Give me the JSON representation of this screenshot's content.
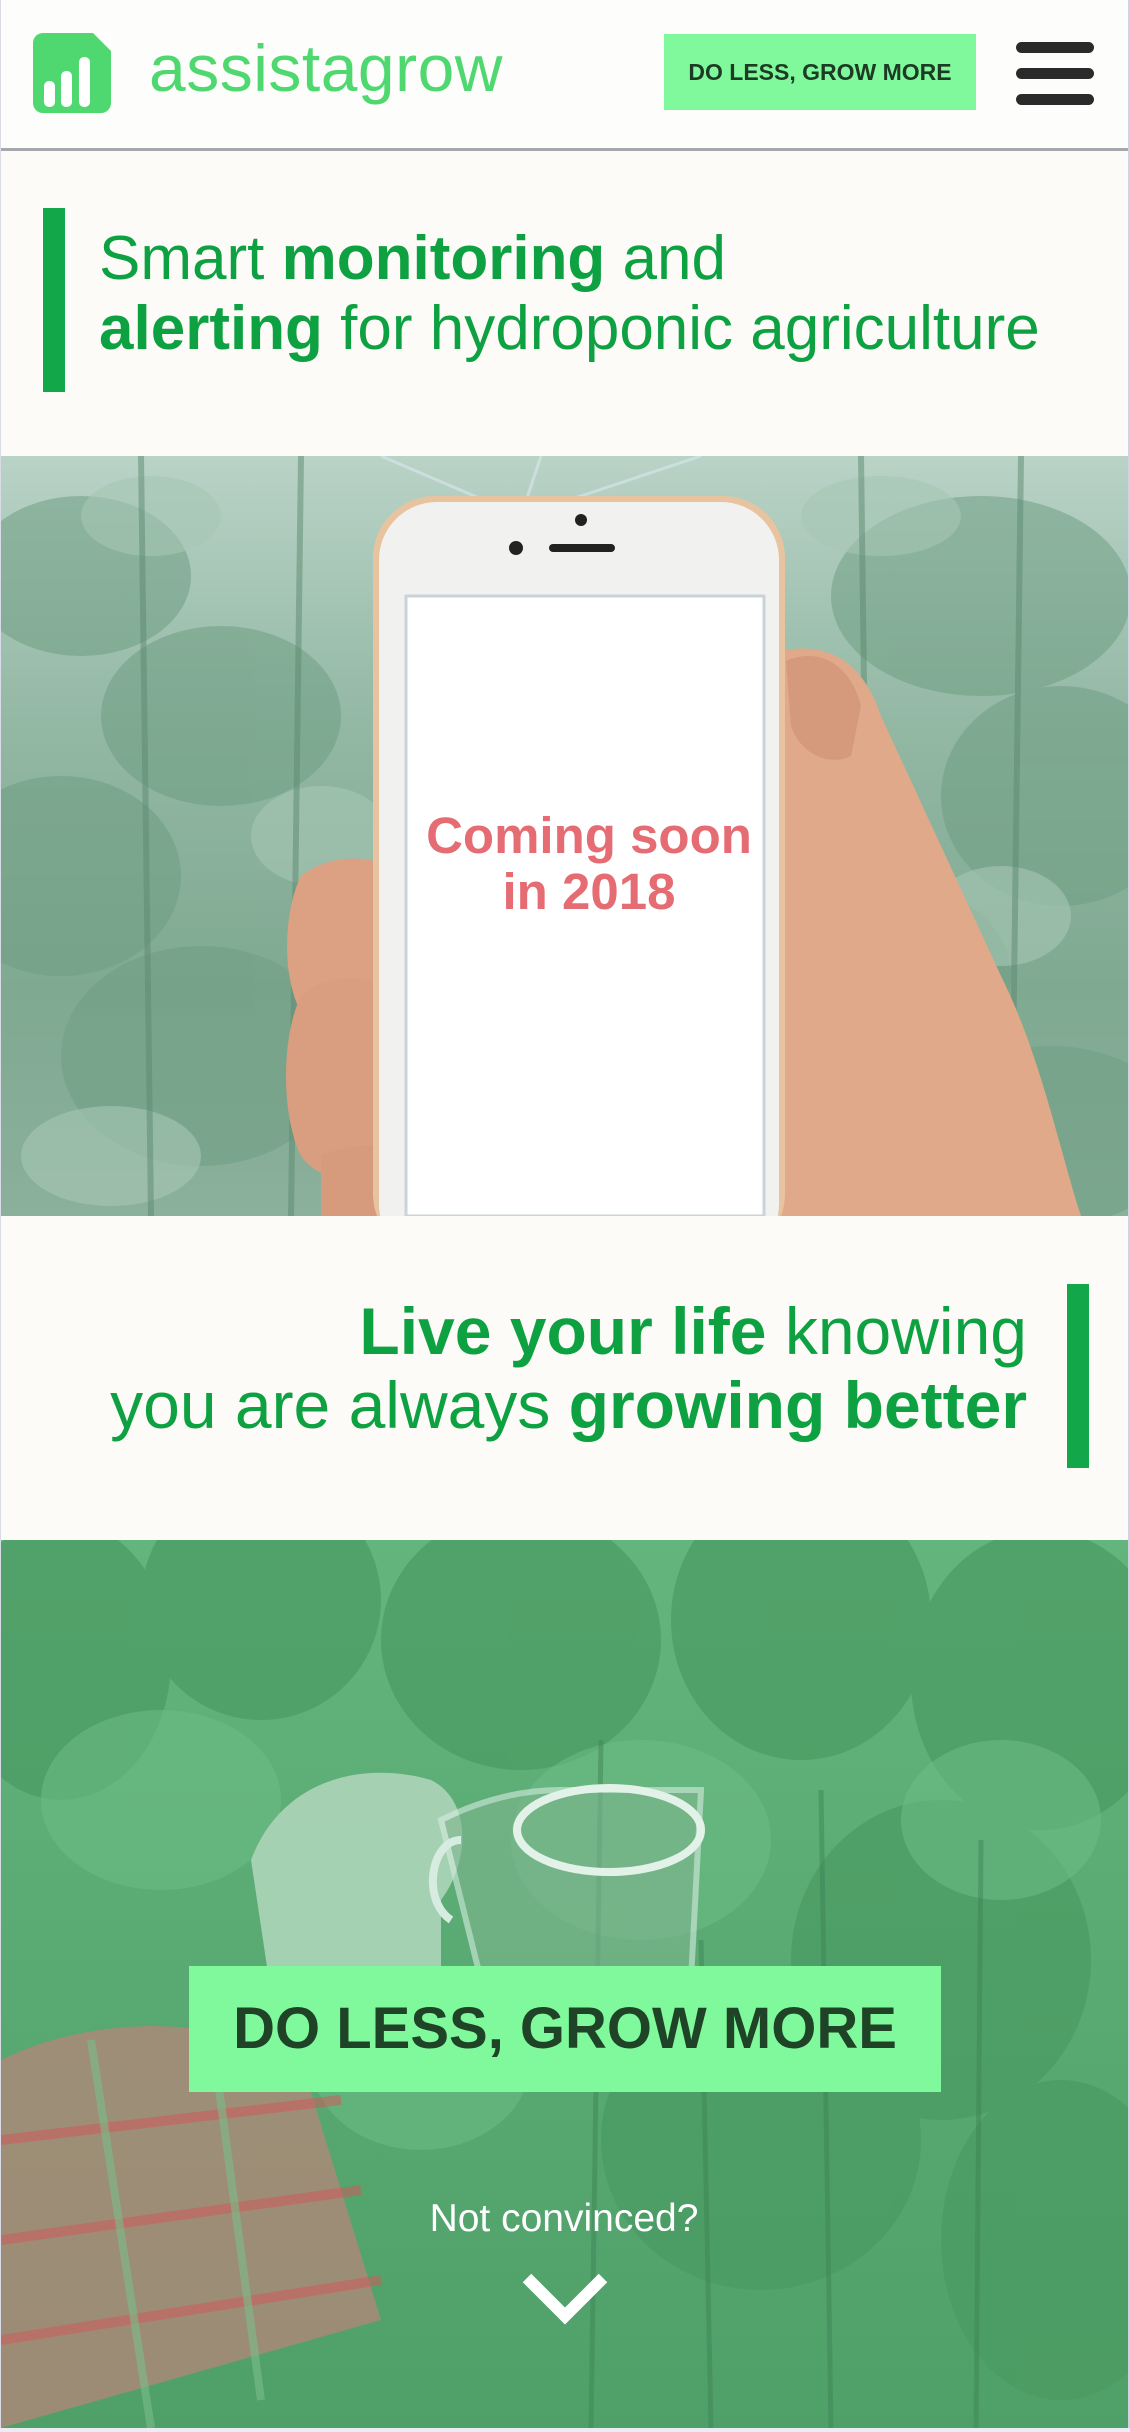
{
  "header": {
    "brand": "assistagrow",
    "logo_icon": "bar-chart-logo-icon",
    "cta_label": "DO LESS, GROW MORE",
    "menu_icon": "hamburger-menu-icon"
  },
  "hero_text": {
    "line1_pre": "Smart ",
    "line1_bold": "monitoring",
    "line1_post": " and",
    "line2_bold": "alerting",
    "line2_post": " for hydroponic agriculture"
  },
  "phone": {
    "screen_text_line1": "Coming soon",
    "screen_text_line2": "in 2018"
  },
  "tagline": {
    "line1_bold": "Live your life",
    "line1_post": " knowing",
    "line2_pre": "you are always ",
    "line2_bold": "growing better"
  },
  "cta": {
    "main_label": "DO LESS, GROW MORE",
    "secondary_label": "Not convinced?",
    "scroll_icon": "chevron-down-icon"
  },
  "colors": {
    "brand_green": "#4fd86f",
    "accent_green": "#0ea142",
    "button_green": "#7ff99b",
    "coming_soon_red": "#e46c72"
  }
}
